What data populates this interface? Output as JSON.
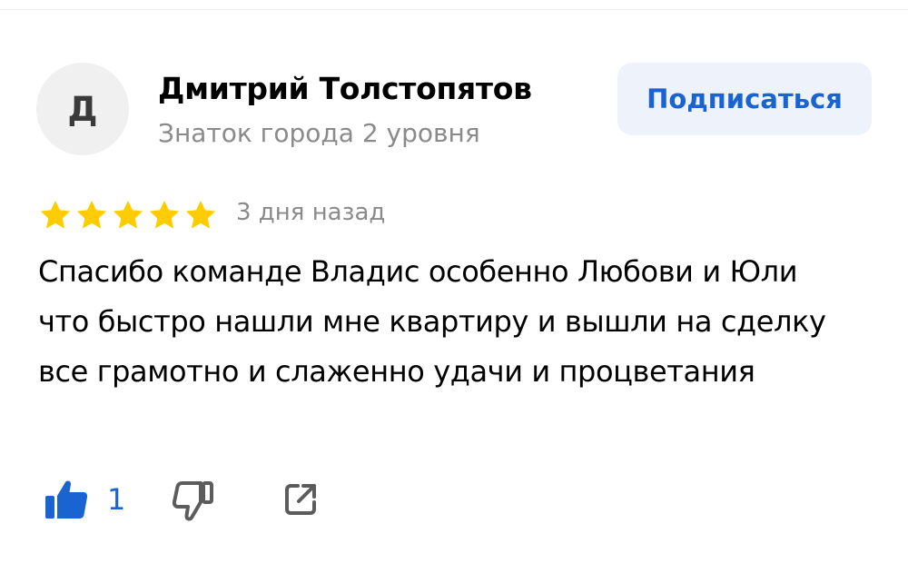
{
  "author": {
    "avatar_letter": "Д",
    "name": "Дмитрий Толстопятов",
    "level": "Знаток города 2 уровня"
  },
  "subscribe": {
    "label": "Подписаться"
  },
  "review": {
    "rating": 5,
    "date": "3 дня назад",
    "text": "Спасибо команде Владис особенно Любови и Юли что быстро нашли мне квартиру и вышли на сделку все грамотно и слаженно удачи и процветания"
  },
  "actions": {
    "like_count": "1",
    "like_icon": "thumbs-up-icon",
    "dislike_icon": "thumbs-down-icon",
    "share_icon": "share-icon"
  },
  "colors": {
    "accent": "#1a64d2",
    "star": "#ffcc00",
    "muted_text": "#8a8a8a",
    "subscribe_bg": "#eef3fb",
    "avatar_bg": "#f0f0f0"
  }
}
